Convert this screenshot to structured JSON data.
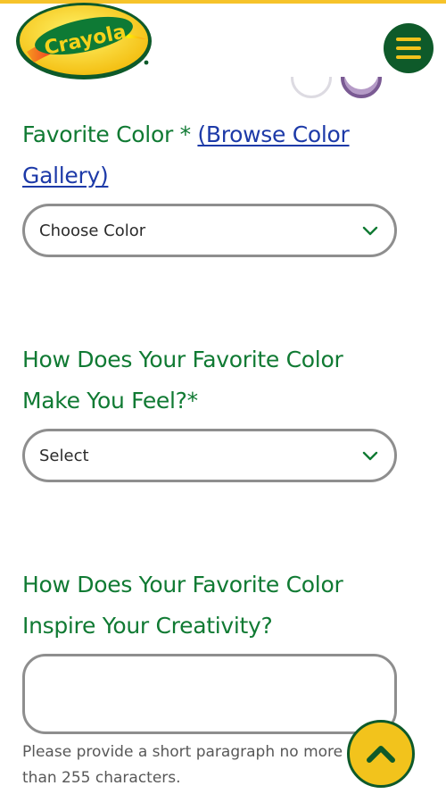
{
  "header": {
    "brand": "Crayola",
    "menu_icon": "hamburger-menu-icon"
  },
  "form": {
    "favorite_color": {
      "label": "Favorite Color * ",
      "link_text": "(Browse Color Gallery)",
      "selected": "Choose Color"
    },
    "feel": {
      "label": "How Does Your Favorite Color Make You Feel?*",
      "selected": "Select"
    },
    "inspire": {
      "label": "How Does Your Favorite Color Inspire Your Creativity?",
      "value": "",
      "helper": "Please provide a short paragraph no more than 255 characters."
    }
  },
  "scroll_top_icon": "chevron-up-icon",
  "colors": {
    "accent_green": "#107a33",
    "dark_green": "#0e5a2a",
    "link_blue": "#1d3aa8",
    "yellow": "#f2c31c"
  }
}
